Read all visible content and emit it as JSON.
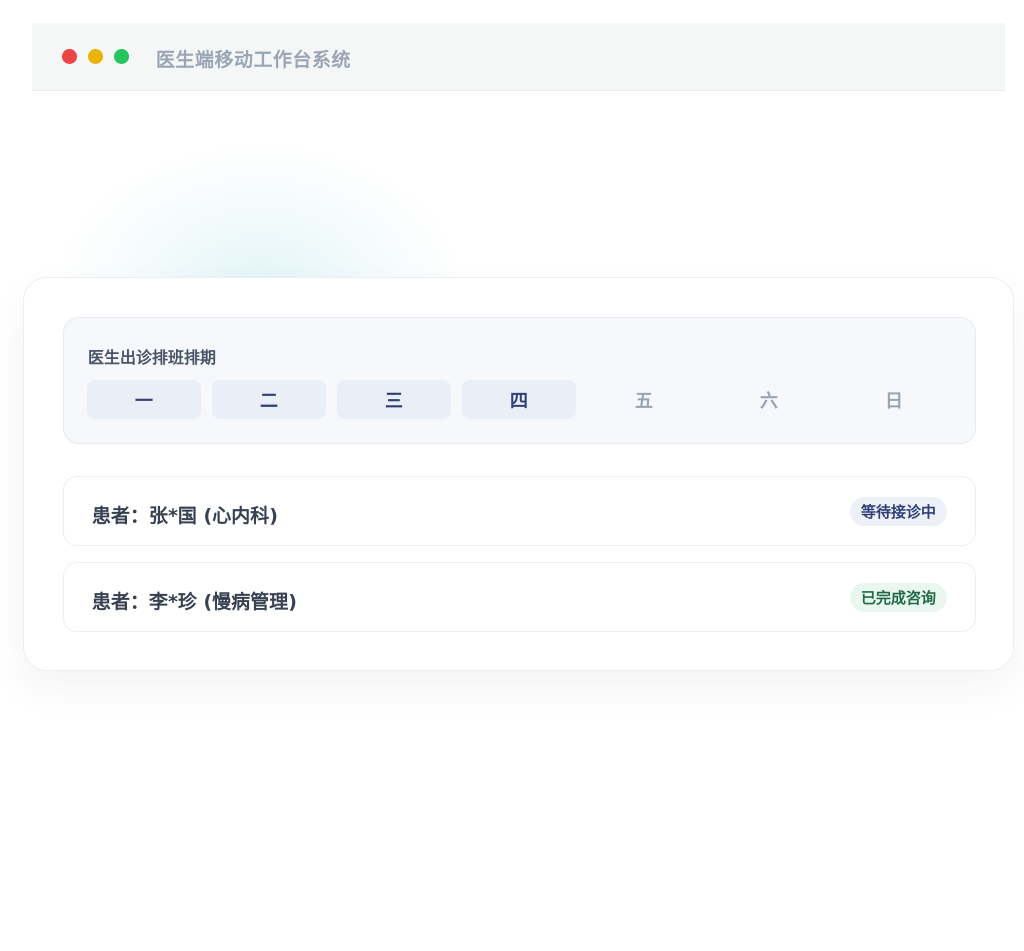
{
  "window": {
    "title": "医生端移动工作台系统",
    "controls": [
      "close",
      "minimize",
      "maximize"
    ]
  },
  "schedule": {
    "title": "医生出诊排班排期",
    "days": [
      {
        "label": "一",
        "active": true
      },
      {
        "label": "二",
        "active": true
      },
      {
        "label": "三",
        "active": true
      },
      {
        "label": "四",
        "active": true
      },
      {
        "label": "五",
        "active": false
      },
      {
        "label": "六",
        "active": false
      },
      {
        "label": "日",
        "active": false
      }
    ]
  },
  "patients": [
    {
      "name": "患者：张*国 (心内科)",
      "status": "等待接诊中",
      "status_type": "waiting"
    },
    {
      "name": "患者：李*珍 (慢病管理)",
      "status": "已完成咨询",
      "status_type": "done"
    }
  ],
  "colors": {
    "close": "#ef4444",
    "minimize": "#eab308",
    "maximize": "#22c55e",
    "active_day_text": "#2d4173",
    "waiting_badge_text": "#2d3f75",
    "done_badge_text": "#1f6b46"
  }
}
